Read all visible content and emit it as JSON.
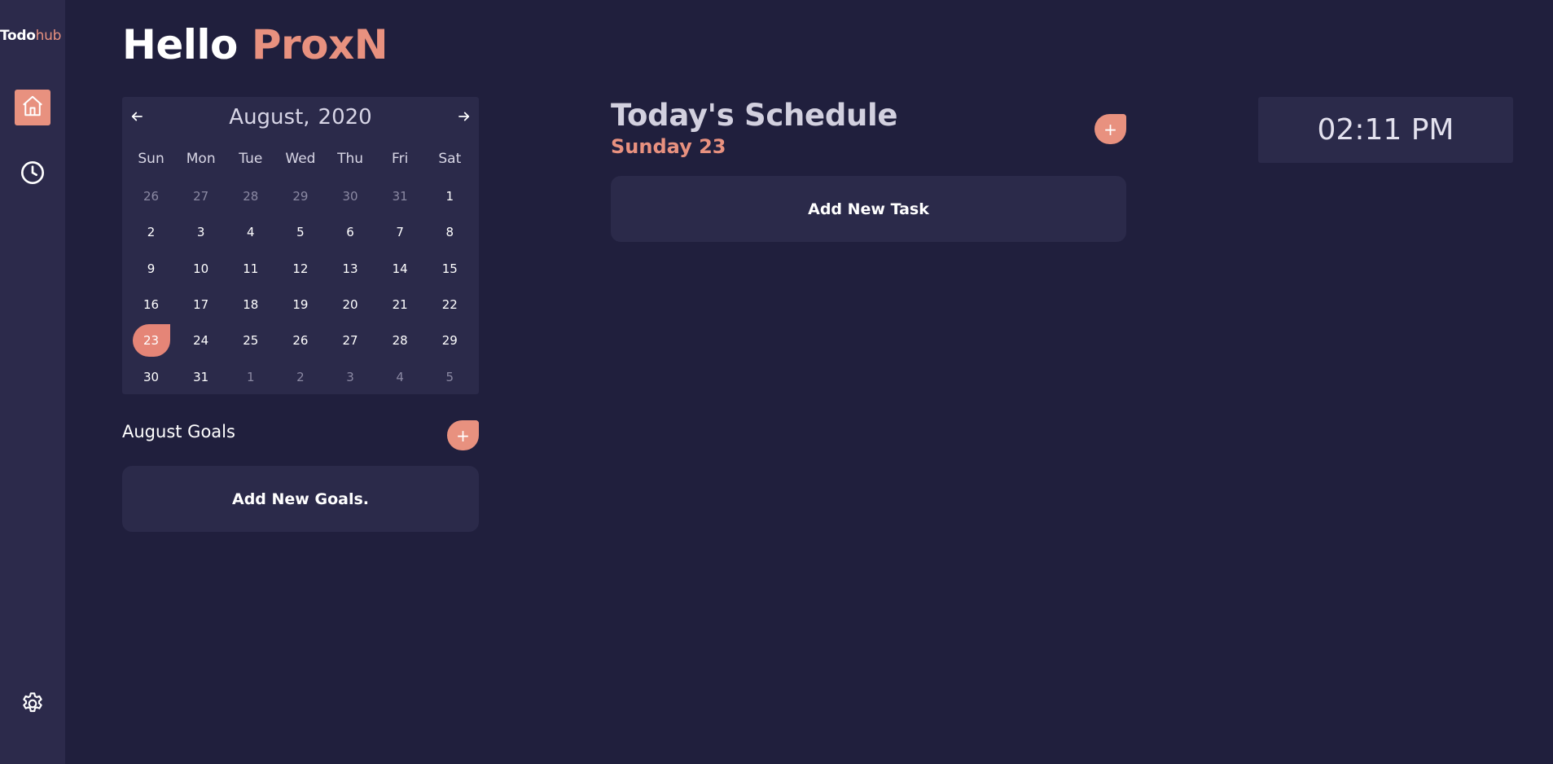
{
  "app": {
    "logo_part1": "Todo",
    "logo_part2": "hub",
    "accent_color": "#e8917f",
    "background_color": "#201f3d",
    "panel_color": "#2b2a4a"
  },
  "sidebar": {
    "items": [
      {
        "name": "home",
        "icon": "home-icon",
        "active": true
      },
      {
        "name": "history",
        "icon": "clock-icon",
        "active": false
      },
      {
        "name": "settings",
        "icon": "gear-icon",
        "active": false
      }
    ]
  },
  "header": {
    "greeting": "Hello",
    "username": "ProxN"
  },
  "calendar": {
    "month": "August,",
    "year": "2020",
    "prev_icon": "arrow-left-icon",
    "next_icon": "arrow-right-icon",
    "weekdays": [
      "Sun",
      "Mon",
      "Tue",
      "Wed",
      "Thu",
      "Fri",
      "Sat"
    ],
    "weeks": [
      [
        {
          "d": "26",
          "m": true
        },
        {
          "d": "27",
          "m": true
        },
        {
          "d": "28",
          "m": true
        },
        {
          "d": "29",
          "m": true
        },
        {
          "d": "30",
          "m": true
        },
        {
          "d": "31",
          "m": true
        },
        {
          "d": "1",
          "m": false
        }
      ],
      [
        {
          "d": "2",
          "m": false
        },
        {
          "d": "3",
          "m": false
        },
        {
          "d": "4",
          "m": false
        },
        {
          "d": "5",
          "m": false
        },
        {
          "d": "6",
          "m": false
        },
        {
          "d": "7",
          "m": false
        },
        {
          "d": "8",
          "m": false
        }
      ],
      [
        {
          "d": "9",
          "m": false
        },
        {
          "d": "10",
          "m": false
        },
        {
          "d": "11",
          "m": false
        },
        {
          "d": "12",
          "m": false
        },
        {
          "d": "13",
          "m": false
        },
        {
          "d": "14",
          "m": false
        },
        {
          "d": "15",
          "m": false
        }
      ],
      [
        {
          "d": "16",
          "m": false
        },
        {
          "d": "17",
          "m": false
        },
        {
          "d": "18",
          "m": false
        },
        {
          "d": "19",
          "m": false
        },
        {
          "d": "20",
          "m": false
        },
        {
          "d": "21",
          "m": false
        },
        {
          "d": "22",
          "m": false
        }
      ],
      [
        {
          "d": "23",
          "m": false,
          "sel": true
        },
        {
          "d": "24",
          "m": false
        },
        {
          "d": "25",
          "m": false
        },
        {
          "d": "26",
          "m": false
        },
        {
          "d": "27",
          "m": false
        },
        {
          "d": "28",
          "m": false
        },
        {
          "d": "29",
          "m": false
        }
      ],
      [
        {
          "d": "30",
          "m": false
        },
        {
          "d": "31",
          "m": false
        },
        {
          "d": "1",
          "m": true
        },
        {
          "d": "2",
          "m": true
        },
        {
          "d": "3",
          "m": true
        },
        {
          "d": "4",
          "m": true
        },
        {
          "d": "5",
          "m": true
        }
      ]
    ]
  },
  "goals": {
    "title": "August Goals",
    "add_label": "+",
    "empty_label": "Add New Goals."
  },
  "schedule": {
    "title": "Today's Schedule",
    "subtitle": "Sunday 23",
    "add_label": "+",
    "empty_label": "Add New Task"
  },
  "clock": {
    "time": "02:11 PM"
  }
}
